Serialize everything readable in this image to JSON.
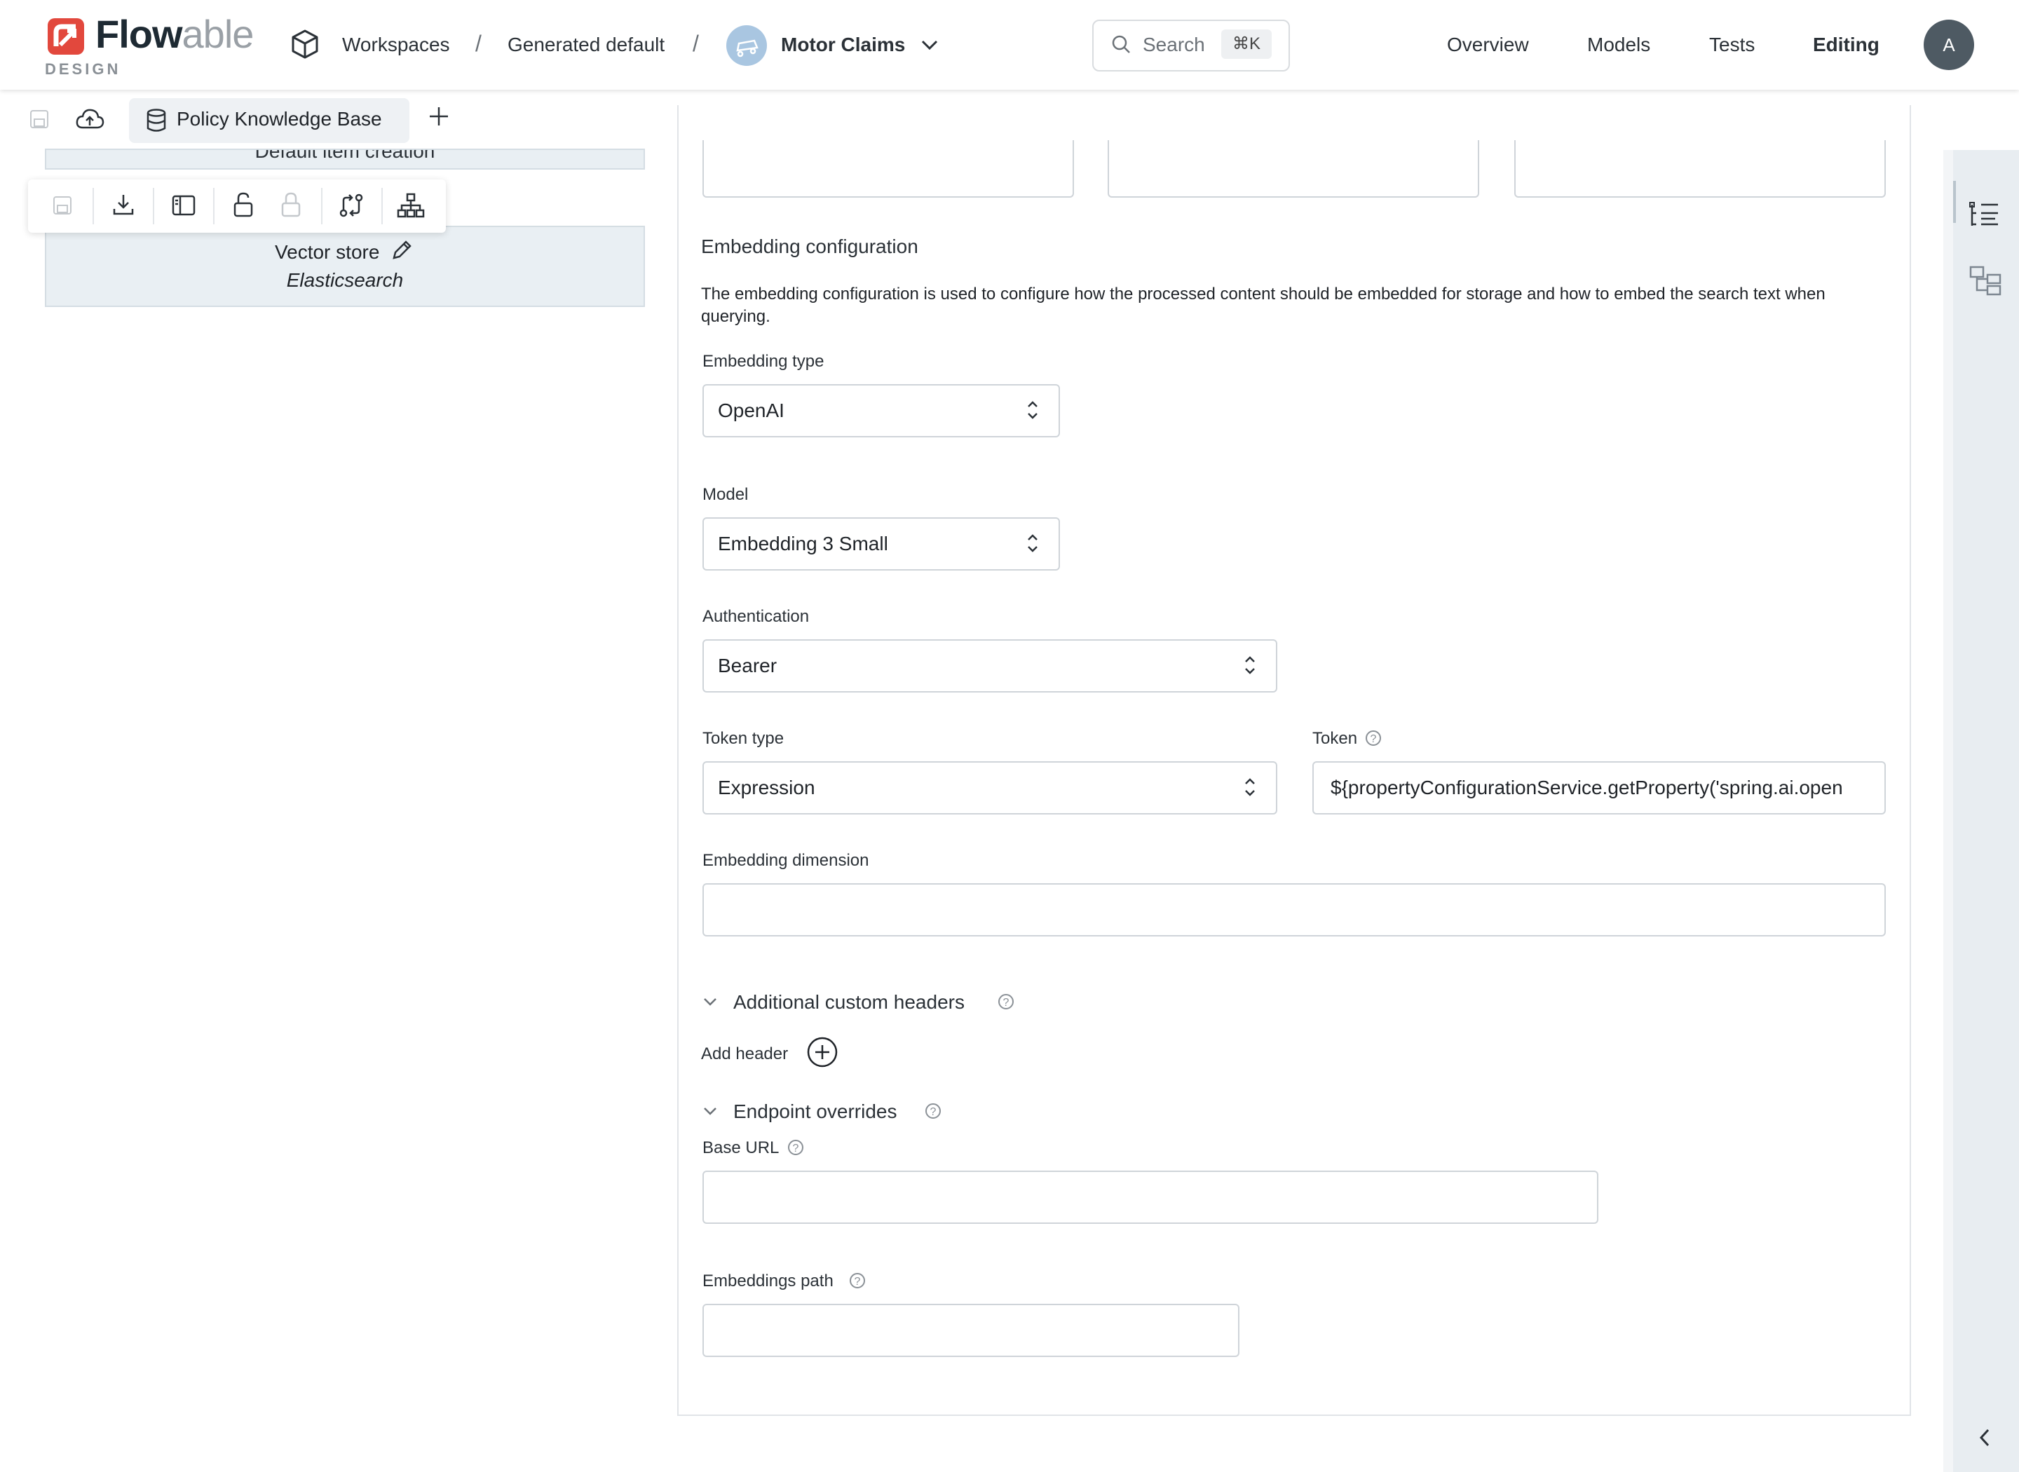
{
  "header": {
    "logo_main": "Flow",
    "logo_lite": "able",
    "logo_sub": "DESIGN",
    "breadcrumb": [
      "Workspaces",
      "Generated default"
    ],
    "separator": "/",
    "app_name": "Motor Claims",
    "search_placeholder": "Search",
    "search_shortcut": "⌘K",
    "nav": [
      "Overview",
      "Models",
      "Tests",
      "Editing"
    ],
    "avatar_initial": "A"
  },
  "tabs": {
    "active_tab": "Policy Knowledge Base",
    "add": "+"
  },
  "left_panel": {
    "node_partial": "Default item creation",
    "vector_store_label": "Vector store",
    "vector_store_value": "Elasticsearch"
  },
  "form": {
    "embedding_section_title": "Embedding configuration",
    "embedding_description": "The embedding configuration is used to configure how the processed content should be embedded for storage and how to embed the search text when querying.",
    "embedding_type_label": "Embedding type",
    "embedding_type_value": "OpenAI",
    "model_label": "Model",
    "model_value": "Embedding 3 Small",
    "authentication_label": "Authentication",
    "authentication_value": "Bearer",
    "token_type_label": "Token type",
    "token_type_value": "Expression",
    "token_label": "Token",
    "token_value": "${propertyConfigurationService.getProperty('spring.ai.open",
    "embedding_dimension_label": "Embedding dimension",
    "embedding_dimension_value": "",
    "custom_headers_title": "Additional custom headers",
    "add_header_label": "Add header",
    "endpoint_overrides_title": "Endpoint overrides",
    "base_url_label": "Base URL",
    "base_url_value": "",
    "embeddings_path_label": "Embeddings path",
    "embeddings_path_value": "",
    "help_glyph": "?"
  },
  "colors": {
    "brand_red": "#e2483d",
    "accent_blue": "#a9c6e1",
    "rail_bg": "#e8edf1"
  }
}
